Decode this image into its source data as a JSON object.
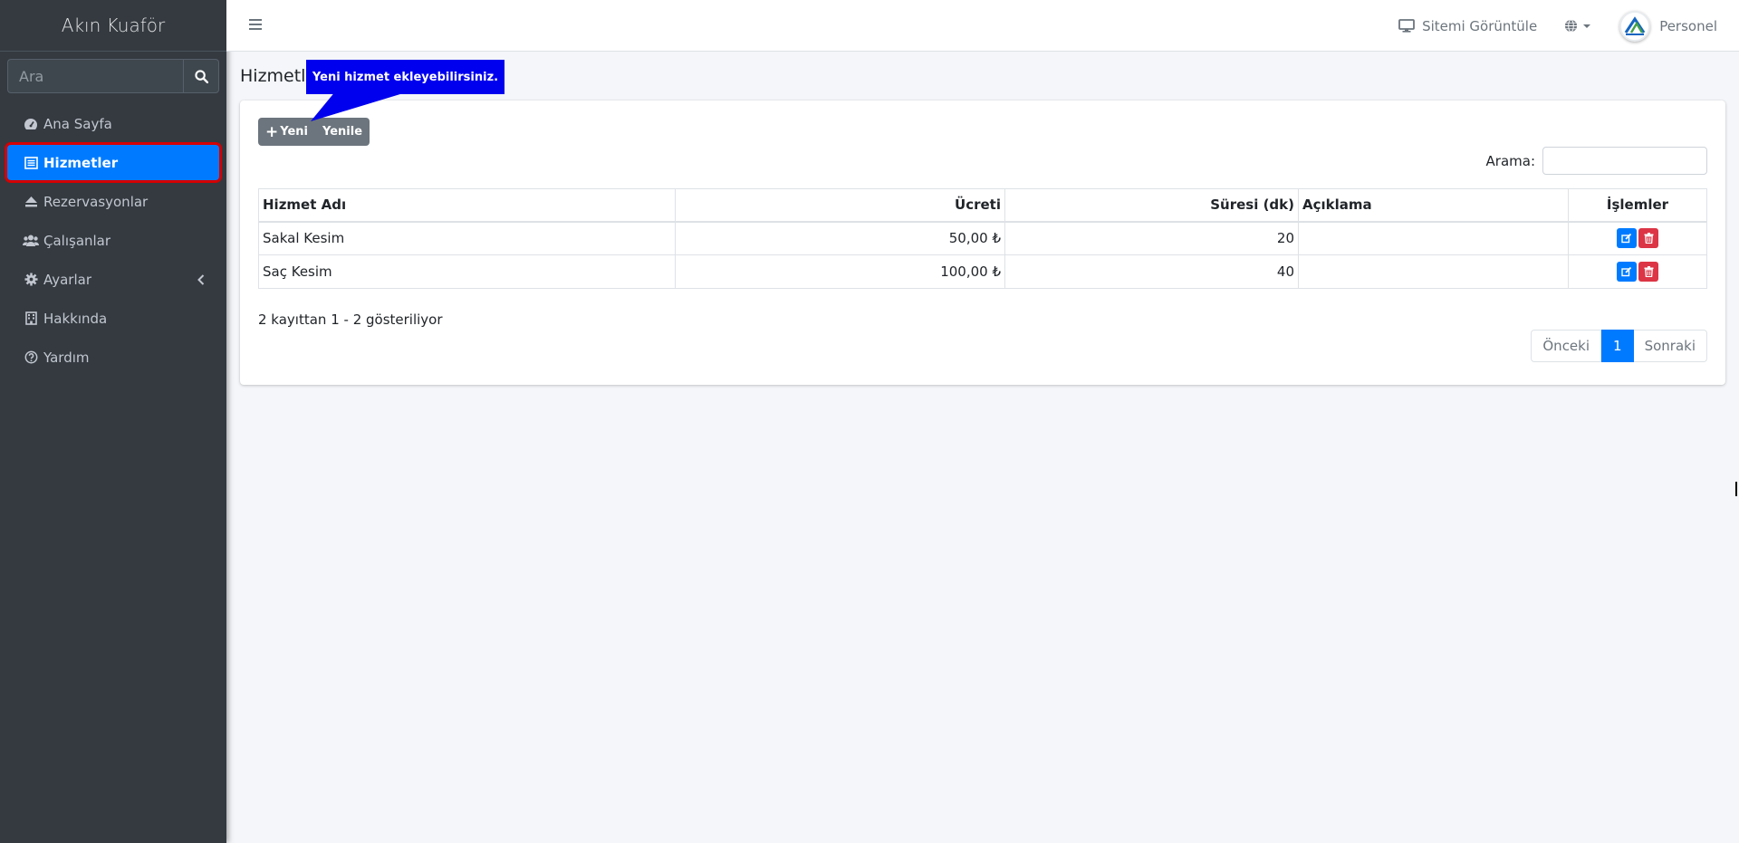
{
  "sidebar": {
    "brand": "Akın Kuaför",
    "search_placeholder": "Ara",
    "items": [
      {
        "label": "Ana Sayfa",
        "icon": "tachometer-icon"
      },
      {
        "label": "Hizmetler",
        "icon": "list-icon",
        "active": true
      },
      {
        "label": "Rezervasyonlar",
        "icon": "eject-icon"
      },
      {
        "label": "Çalışanlar",
        "icon": "users-icon"
      },
      {
        "label": "Ayarlar",
        "icon": "gear-icon",
        "has_submenu": true
      },
      {
        "label": "Hakkında",
        "icon": "building-icon"
      },
      {
        "label": "Yardım",
        "icon": "question-icon"
      }
    ]
  },
  "navbar": {
    "site_link": "Sitemi Görüntüle",
    "user": "Personel"
  },
  "page": {
    "title": "Hizmetler",
    "callout": "Yeni hizmet ekleyebilirsiniz."
  },
  "toolbar": {
    "new_label": "Yeni",
    "refresh_label": "Yenile",
    "search_label": "Arama:"
  },
  "table": {
    "headers": [
      "Hizmet Adı",
      "Ücreti",
      "Süresi (dk)",
      "Açıklama",
      "İşlemler"
    ],
    "rows": [
      {
        "name": "Sakal Kesim",
        "price": "50,00 ₺",
        "duration": "20",
        "desc": ""
      },
      {
        "name": "Saç Kesim",
        "price": "100,00 ₺",
        "duration": "40",
        "desc": ""
      }
    ]
  },
  "footer": {
    "info": "2 kayıttan 1 - 2 gösteriliyor",
    "prev": "Önceki",
    "page": "1",
    "next": "Sonraki"
  },
  "colors": {
    "sidebar_bg": "#343a40",
    "primary": "#007bff",
    "danger": "#dc3545",
    "highlight": "#d50000",
    "callout": "#0000ee"
  }
}
